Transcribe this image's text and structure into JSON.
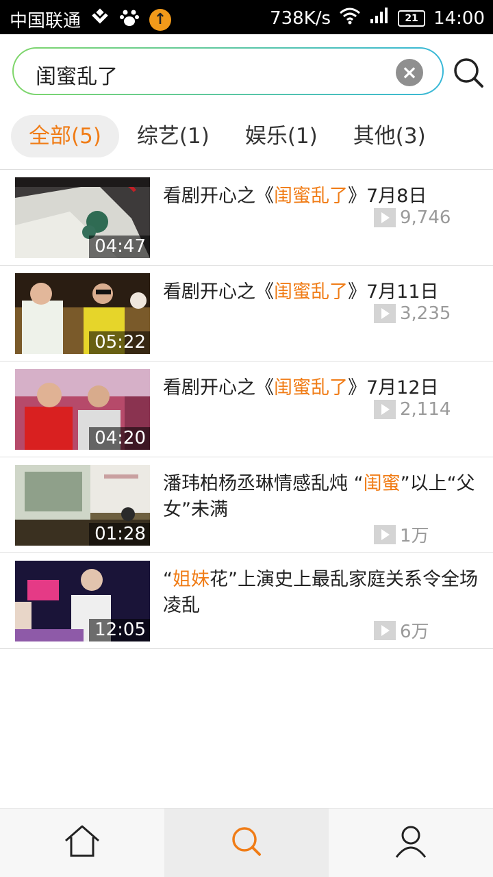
{
  "status_bar": {
    "carrier": "中国联通",
    "speed": "738K/s",
    "battery": "21",
    "time": "14:00"
  },
  "search": {
    "query": "闺蜜乱了"
  },
  "tabs": [
    {
      "label": "全部(5)",
      "active": true
    },
    {
      "label": "综艺(1)",
      "active": false
    },
    {
      "label": "娱乐(1)",
      "active": false
    },
    {
      "label": "其他(3)",
      "active": false
    }
  ],
  "results": [
    {
      "title_pre": "看剧开心之《",
      "title_hl": "闺蜜乱了",
      "title_post": "》7月8日",
      "duration": "04:47",
      "plays": "9,746"
    },
    {
      "title_pre": "看剧开心之《",
      "title_hl": "闺蜜乱了",
      "title_post": "》7月11日",
      "duration": "05:22",
      "plays": "3,235"
    },
    {
      "title_pre": "看剧开心之《",
      "title_hl": "闺蜜乱了",
      "title_post": "》7月12日",
      "duration": "04:20",
      "plays": "2,114"
    },
    {
      "title_pre": "潘玮柏杨丞琳情感乱炖 “",
      "title_hl": "闺蜜",
      "title_post": "”以上“父女”未满",
      "duration": "01:28",
      "plays": "1万"
    },
    {
      "title_pre": "“",
      "title_hl": "姐妹",
      "title_post": "花”上演史上最乱家庭关系令全场凌乱",
      "duration": "12:05",
      "plays": "6万"
    }
  ],
  "colors": {
    "accent": "#f07c16",
    "status_bar_bg": "#000000",
    "search_border_start": "#7fd66a",
    "search_border_end": "#38b8d8"
  },
  "icons": {
    "bottom_nav": [
      "home-icon",
      "search-icon",
      "user-icon"
    ]
  }
}
